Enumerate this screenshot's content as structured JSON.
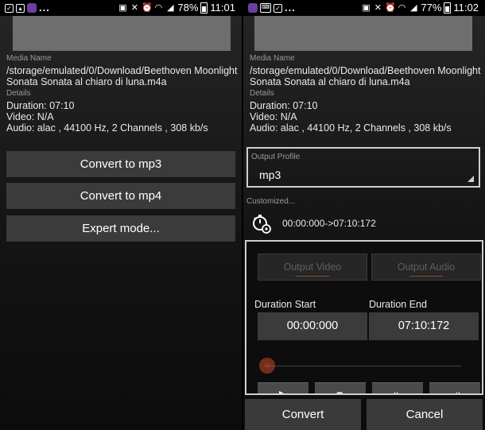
{
  "left": {
    "status": {
      "icons_left": [
        "check-box-icon",
        "image-icon",
        "purple-app-icon"
      ],
      "more": "...",
      "battery": "78%",
      "time": "11:01"
    },
    "media_name_label": "Media Name",
    "media_path_line1": "/storage/emulated/0/Download/Beethoven Moonlight",
    "media_path_line2": "Sonata Sonata al chiaro di luna.m4a",
    "details_label": "Details",
    "duration": "Duration: 07:10",
    "video": "Video: N/A",
    "audio": "Audio: alac , 44100 Hz, 2 Channels , 308 kb/s",
    "buttons": {
      "convert_mp3": "Convert to mp3",
      "convert_mp4": "Convert to mp4",
      "expert": "Expert mode..."
    }
  },
  "right": {
    "status": {
      "icons_left": [
        "purple-app-icon",
        "keyboard-icon",
        "check-box-icon"
      ],
      "more": "...",
      "battery": "77%",
      "time": "11:02"
    },
    "media_name_label": "Media Name",
    "media_path_line1": "/storage/emulated/0/Download/Beethoven Moonlight",
    "media_path_line2": "Sonata Sonata al chiaro di luna.m4a",
    "details_label": "Details",
    "duration": "Duration: 07:10",
    "video": "Video: N/A",
    "audio": "Audio: alac , 44100 Hz, 2 Channels , 308 kb/s",
    "output_profile": {
      "label": "Output Profile",
      "value": "mp3"
    },
    "customized_label": "Customized...",
    "time_range": "00:00:000->07:10:172",
    "tabs": {
      "output_video": "Output Video",
      "output_audio": "Output Audio"
    },
    "duration_start_label": "Duration Start",
    "duration_end_label": "Duration End",
    "duration_start_value": "00:00:000",
    "duration_end_value": "07:10:172",
    "seek_position": 0,
    "footer": {
      "convert": "Convert",
      "cancel": "Cancel"
    }
  }
}
